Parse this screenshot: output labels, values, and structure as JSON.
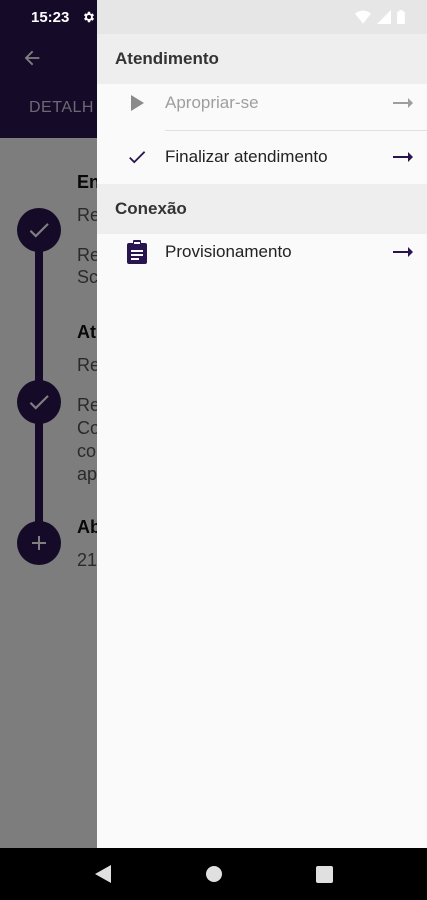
{
  "status_bar": {
    "time": "15:23"
  },
  "background": {
    "tab_label": "DETALH",
    "timeline": [
      {
        "icon": "check-icon",
        "title": "En",
        "lines": [
          "Re",
          "",
          "Re",
          "Sc"
        ]
      },
      {
        "icon": "check-icon",
        "title": "At",
        "lines": [
          "Re",
          "",
          "Re",
          "Co",
          "co",
          "ap"
        ]
      },
      {
        "icon": "plus-icon",
        "title": "Ab",
        "lines": [
          "21"
        ]
      }
    ]
  },
  "drawer": {
    "sections": [
      {
        "title": "Atendimento",
        "items": [
          {
            "label": "Apropriar-se",
            "icon": "play-icon",
            "enabled": false
          },
          {
            "label": "Finalizar atendimento",
            "icon": "check-icon",
            "enabled": true
          }
        ]
      },
      {
        "title": "Conexão",
        "items": [
          {
            "label": "Provisionamento",
            "icon": "clipboard-icon",
            "enabled": true
          }
        ]
      }
    ]
  },
  "colors": {
    "primary": "#2a1450",
    "disabled": "#9e9e9e",
    "text": "#222222"
  }
}
